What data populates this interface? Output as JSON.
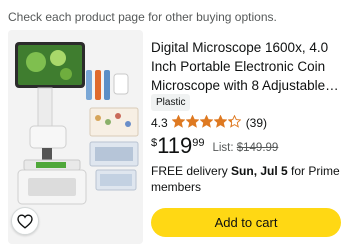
{
  "notice": "Check each product page for other buying options.",
  "product": {
    "title": "Digital Microscope 1600x, 4.0 Inch Portable Electronic Coin Microscope with 8 Adjustable…",
    "badge": "Plastic",
    "rating": "4.3",
    "rating_value": 4.3,
    "rating_max": 5,
    "reviews": "(39)",
    "price": {
      "currency": "$",
      "whole": "119",
      "fraction": "99"
    },
    "list_label": "List:",
    "list_price": "$149.99",
    "delivery": {
      "prefix": "FREE delivery ",
      "date": "Sun, Jul 5",
      "suffix": " for Prime members"
    },
    "add_to_cart": "Add to cart"
  },
  "icons": {
    "wishlist": "heart-outline-icon",
    "star": "star-icon"
  },
  "colors": {
    "star": "#de7921",
    "cart_button": "#ffd814",
    "muted_text": "#565959",
    "badge_bg": "#f0f2f2"
  }
}
